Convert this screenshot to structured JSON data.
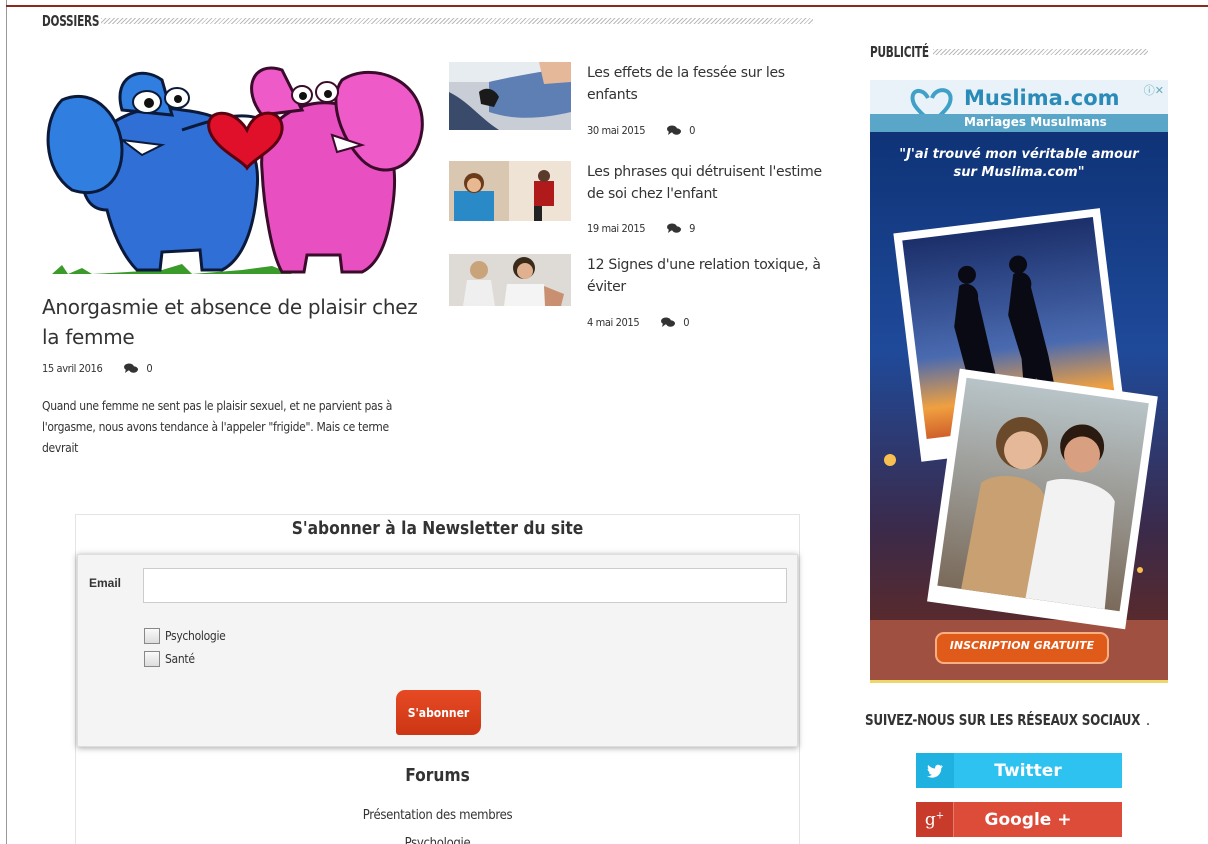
{
  "sections": {
    "dossiers": "DOSSIERS",
    "publicite": "PUBLICITÉ",
    "social": "SUIVEZ-NOUS SUR LES RÉSEAUX SOCIAUX"
  },
  "feature": {
    "title": "Anorgasmie et absence de plaisir chez la femme",
    "date": "15 avril 2016",
    "comments": "0",
    "excerpt": "Quand une femme ne sent pas le plaisir sexuel, et ne parvient pas à l'orgasme, nous avons tendance à l'appeler \"frigide\". Mais ce terme devrait"
  },
  "articles": [
    {
      "title": "Les effets de la fessée sur les enfants",
      "date": "30 mai 2015",
      "comments": "0"
    },
    {
      "title": "Les phrases qui détruisent l'estime de soi chez l'enfant",
      "date": "19 mai 2015",
      "comments": "9"
    },
    {
      "title": "12 Signes d'une relation toxique, à éviter",
      "date": "4 mai 2015",
      "comments": "0"
    }
  ],
  "newsletter": {
    "title": "S'abonner à la Newsletter du site",
    "email_label": "Email",
    "email_value": "",
    "options": [
      "Psychologie",
      "Santé"
    ],
    "submit": "S'abonner"
  },
  "forums": {
    "title": "Forums",
    "links": [
      "Présentation des membres",
      "Psychologie"
    ]
  },
  "ad": {
    "brand": "Muslima.com",
    "tagline": "Mariages Musulmans",
    "quote_line1": "\"J'ai trouvé mon véritable amour",
    "quote_line2": "sur Muslima.com\"",
    "cta": "INSCRIPTION GRATUITE",
    "corner": "ⓘ✕"
  },
  "social": {
    "twitter": "Twitter",
    "google": "Google +"
  },
  "colors": {
    "accent": "#d6401a",
    "twitter": "#2dc2ef",
    "google": "#dd4b39"
  }
}
